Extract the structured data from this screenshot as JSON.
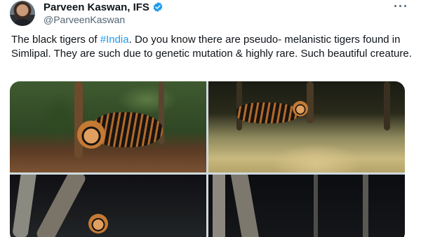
{
  "author": {
    "name": "Parveen Kaswan, IFS",
    "handle": "@ParveenKaswan",
    "verified": true,
    "avatar_icon": "profile-photo"
  },
  "more_icon": "ellipsis-icon",
  "tweet": {
    "text_before": "The black tigers of ",
    "hashtag": "#India",
    "text_after": ". Do you know there are pseudo- melanistic tigers found in Simlipal. They are such due to genetic mutation & highly rare. Such beautiful creature."
  },
  "colors": {
    "link": "#1d9bf0",
    "verified": "#1d9bf0",
    "text": "#0f1419",
    "muted": "#536471"
  },
  "media": {
    "count": 4,
    "photos": [
      "tiger-forest-day",
      "tiger-night-camera-1",
      "tiger-night-camera-2",
      "forest-night-camera"
    ]
  }
}
